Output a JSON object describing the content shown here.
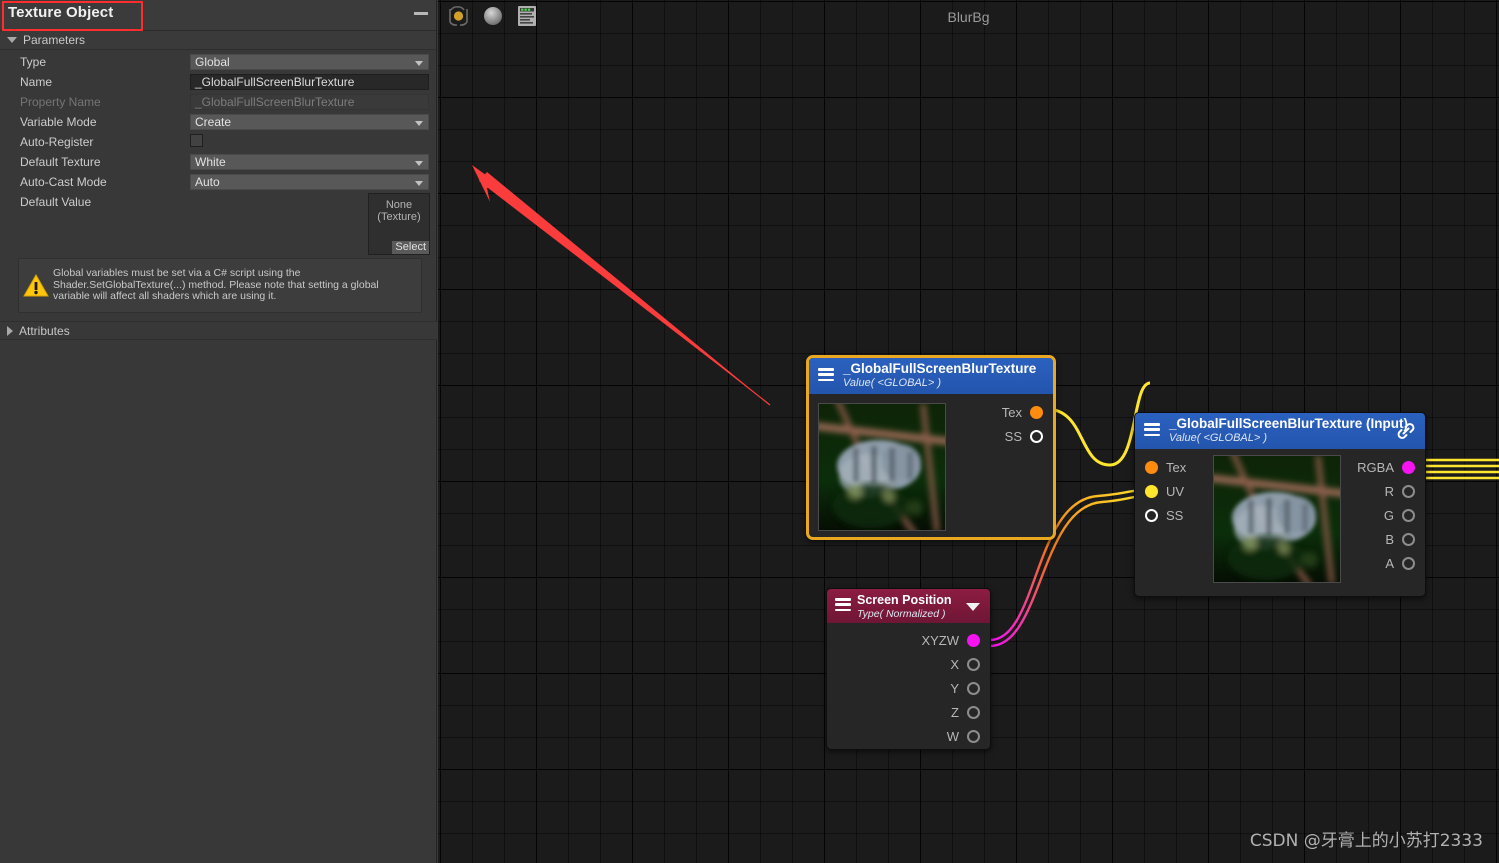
{
  "inspector": {
    "title": "Texture Object",
    "minimize_label": "—",
    "foldouts": {
      "parameters": "Parameters",
      "attributes": "Attributes"
    },
    "rows": [
      {
        "label": "Type",
        "kind": "dropdown",
        "value": "Global"
      },
      {
        "label": "Name",
        "kind": "textfield",
        "value": "_GlobalFullScreenBlurTexture"
      },
      {
        "label": "Property Name",
        "kind": "readonly",
        "value": "_GlobalFullScreenBlurTexture"
      },
      {
        "label": "Variable Mode",
        "kind": "dropdown",
        "value": "Create"
      },
      {
        "label": "Auto-Register",
        "kind": "checkbox",
        "value": ""
      },
      {
        "label": "Default Texture",
        "kind": "dropdown",
        "value": "White"
      },
      {
        "label": "Auto-Cast Mode",
        "kind": "dropdown",
        "value": "Auto"
      },
      {
        "label": "Default Value",
        "kind": "object",
        "value": ""
      }
    ],
    "object_picker": {
      "line1": "None",
      "line2": "(Texture)",
      "select_label": "Select"
    },
    "warning": {
      "icon": "warning-triangle-icon",
      "text": "Global variables must be set via a C# script using the Shader.SetGlobalTexture(...) method.\nPlease note that setting a global variable will affect all shaders which are using it."
    }
  },
  "graph": {
    "title": "BlurBg",
    "toolbar": [
      {
        "name": "save-asset-icon",
        "label": "Save Asset"
      },
      {
        "name": "preview-sphere-icon",
        "label": "Preview"
      },
      {
        "name": "blackboard-icon",
        "label": "Blackboard"
      }
    ],
    "nodes": [
      {
        "id": "texture-property-node",
        "title": "_GlobalFullScreenBlurTexture",
        "subtitle": "Value( <GLOBAL> )",
        "header_color": "#2b61bf",
        "selected": true,
        "selection_color": "#e9a722",
        "has_preview": true,
        "inputs": [],
        "outputs": [
          {
            "label": "Tex",
            "port": "filled-orange"
          },
          {
            "label": "SS",
            "port": "hollow-white"
          }
        ]
      },
      {
        "id": "sample-texture-node",
        "title": "_GlobalFullScreenBlurTexture (Input)",
        "subtitle": "Value( <GLOBAL> )",
        "header_color": "#2b61bf",
        "selected": false,
        "header_icon": "link-icon",
        "has_preview": true,
        "inputs": [
          {
            "label": "Tex",
            "port": "filled-orange"
          },
          {
            "label": "UV",
            "port": "filled-yellow"
          },
          {
            "label": "SS",
            "port": "hollow-white"
          }
        ],
        "outputs": [
          {
            "label": "RGBA",
            "port": "filled-magenta"
          },
          {
            "label": "R",
            "port": "hollow-grey"
          },
          {
            "label": "G",
            "port": "hollow-grey"
          },
          {
            "label": "B",
            "port": "hollow-grey"
          },
          {
            "label": "A",
            "port": "hollow-grey"
          }
        ]
      },
      {
        "id": "screen-position-node",
        "title": "Screen Position",
        "subtitle": "Type( Normalized )",
        "header_color": "#8c1c42",
        "selected": false,
        "header_icon": "chevron-down-icon",
        "has_preview": false,
        "inputs": [],
        "outputs": [
          {
            "label": "XYZW",
            "port": "filled-magenta"
          },
          {
            "label": "X",
            "port": "hollow-grey"
          },
          {
            "label": "Y",
            "port": "hollow-grey"
          },
          {
            "label": "Z",
            "port": "hollow-grey"
          },
          {
            "label": "W",
            "port": "hollow-grey"
          }
        ]
      }
    ],
    "edges": [
      {
        "from": "texture-property-node.Tex",
        "to": "sample-texture-node.Tex",
        "color": "#ffe62e"
      },
      {
        "from": "screen-position-node.XYZW",
        "to": "sample-texture-node.UV",
        "color": "#f513f0"
      },
      {
        "from": "sample-texture-node.RGBA",
        "to": "offscreen",
        "color": "#ffe62e"
      }
    ],
    "annotation": {
      "name": "red-arrow-annotation",
      "color": "#fa3c3c"
    }
  },
  "watermark": "CSDN @牙膏上的小苏打2333"
}
